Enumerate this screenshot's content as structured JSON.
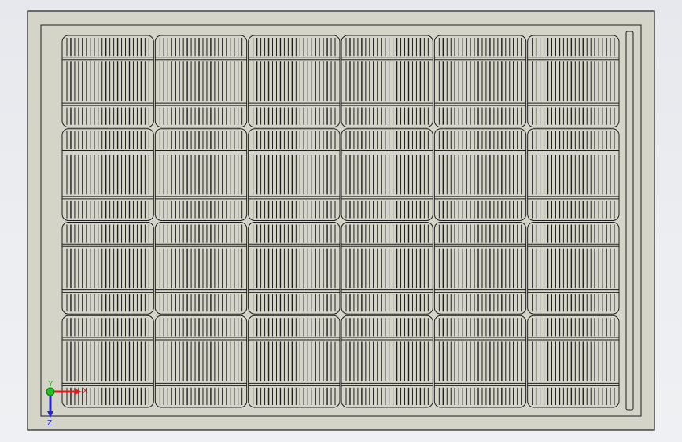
{
  "viewport": {
    "background_color": "#eceef1"
  },
  "model": {
    "frame_fill": "#d4d4c8",
    "line_color": "#1e1e1e",
    "cells_columns": 6,
    "cells_rows": 4
  },
  "triad": {
    "x_label": "X",
    "y_label": "Y",
    "z_label": "Z",
    "x_color": "#e01b1b",
    "y_color": "#1fbf1f",
    "z_color": "#2424d6"
  }
}
